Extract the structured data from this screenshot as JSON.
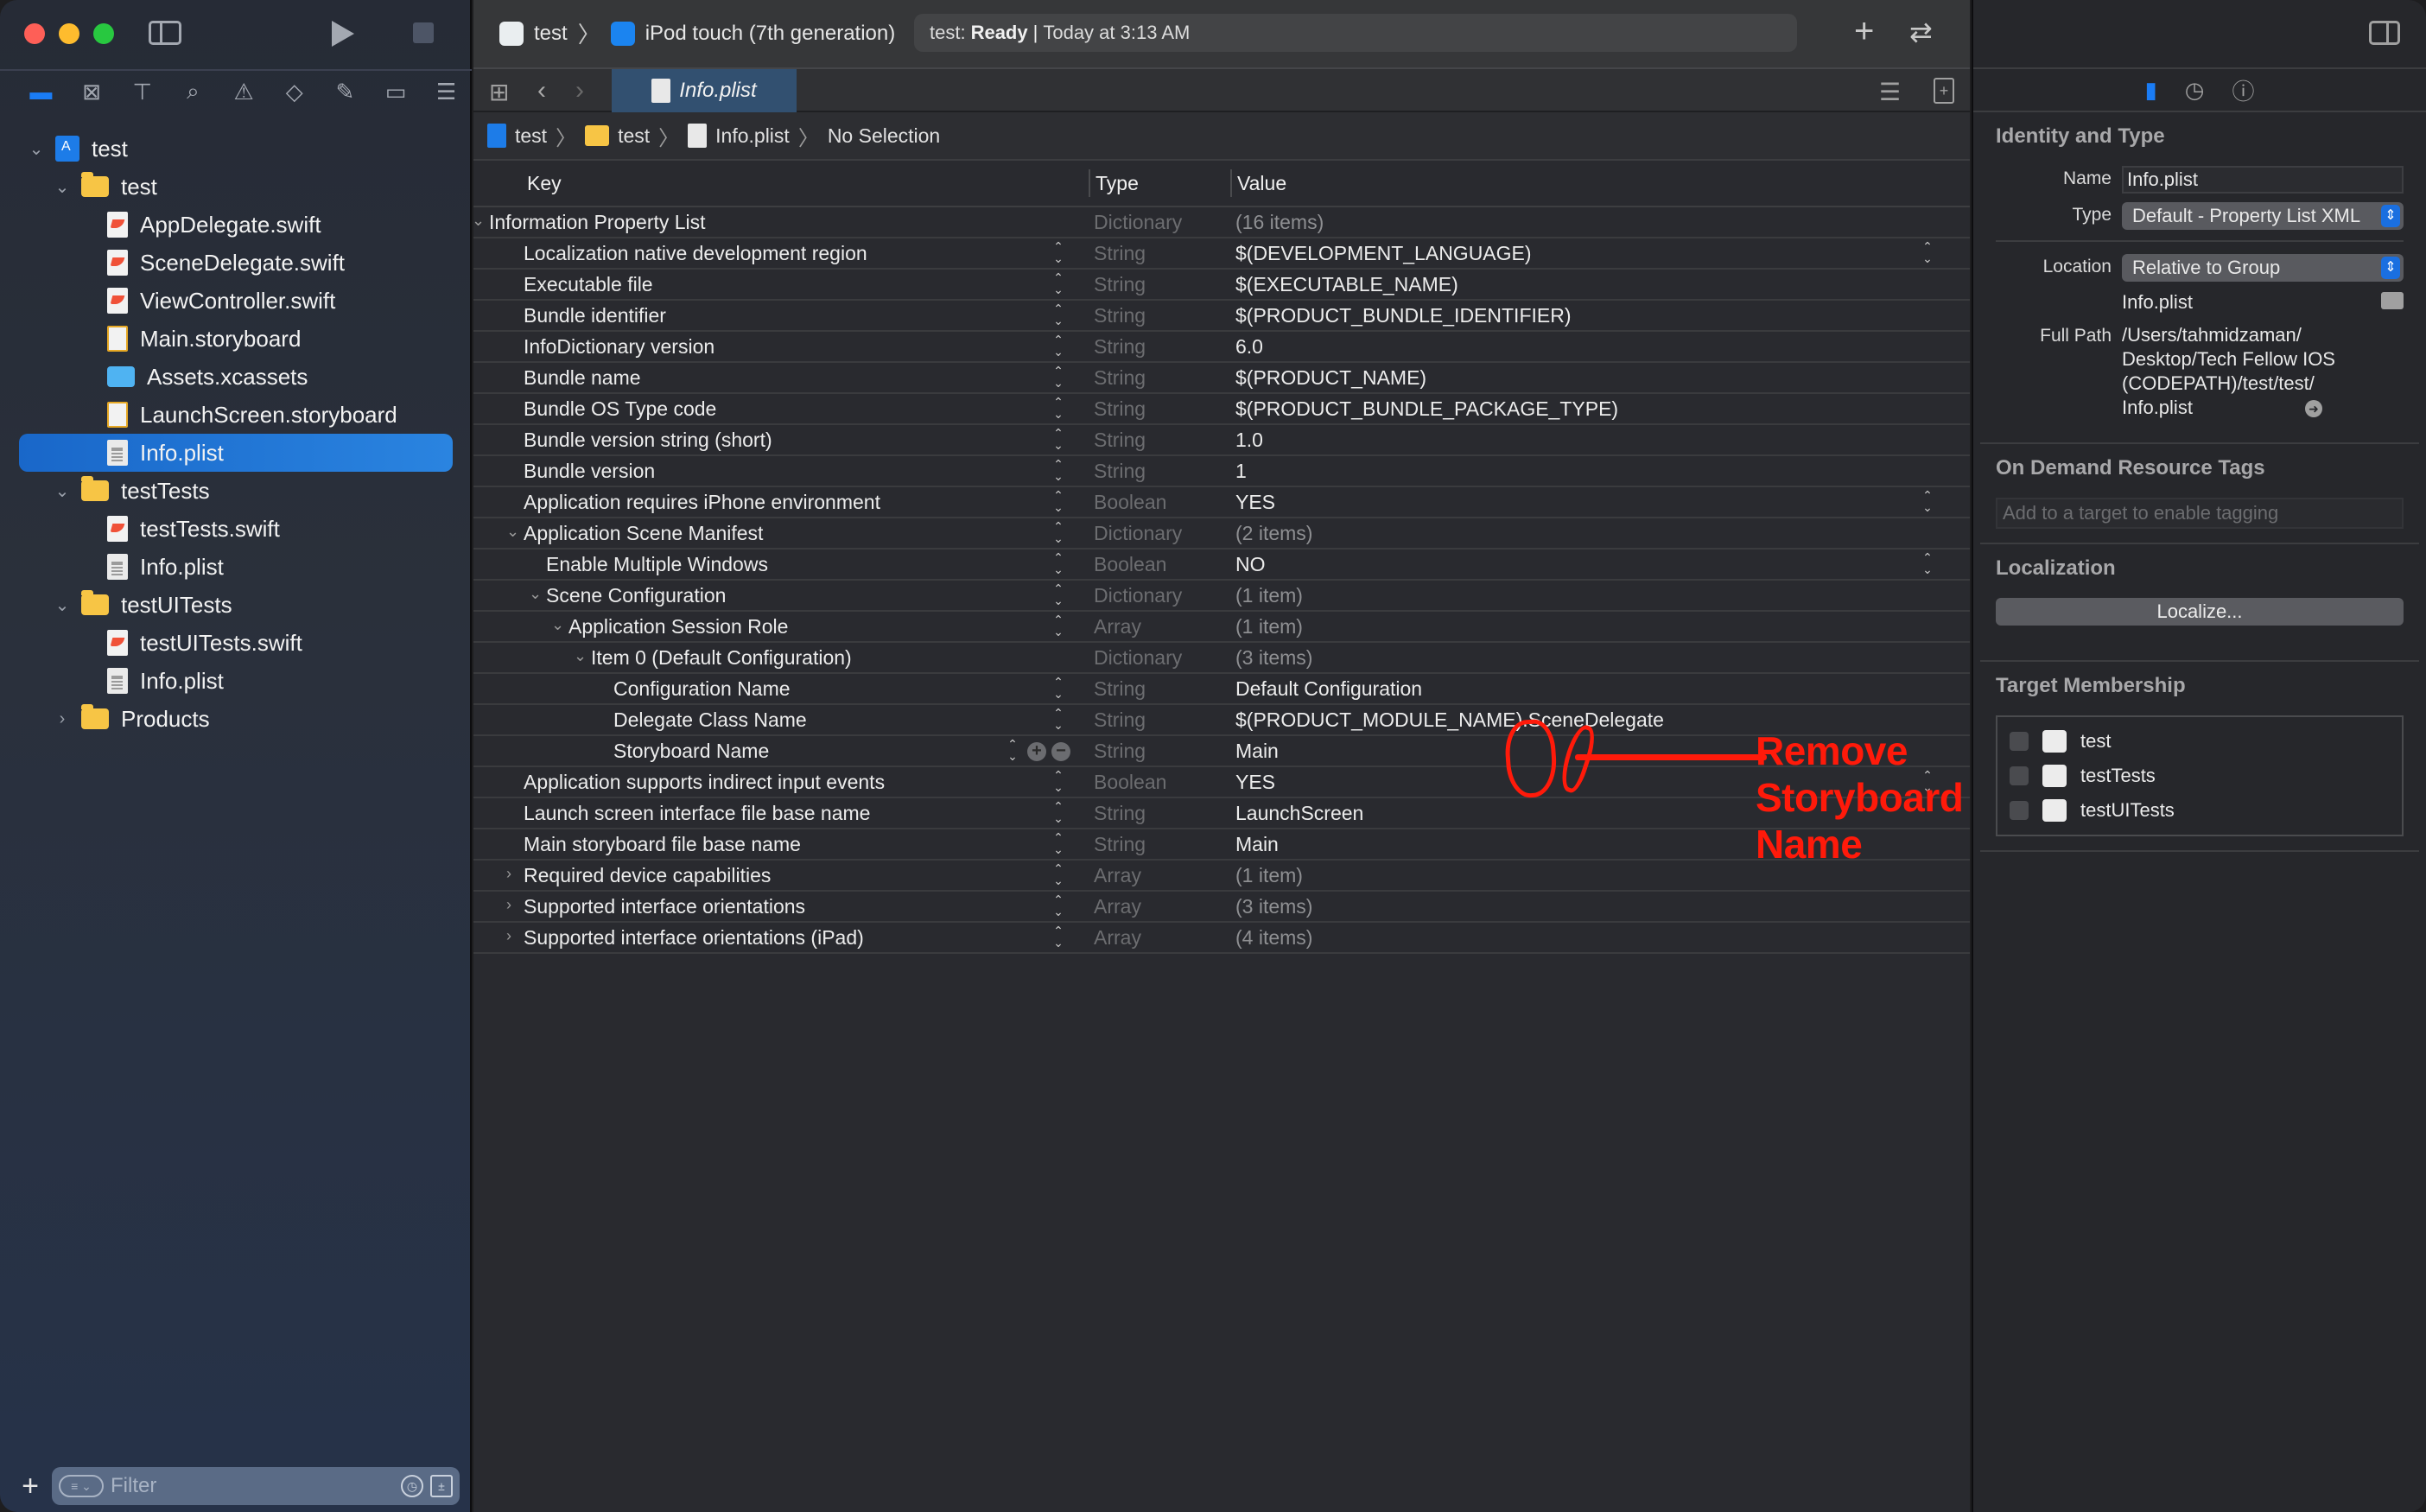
{
  "window": {
    "scheme": {
      "project": "test",
      "device": "iPod touch (7th generation)"
    },
    "status": {
      "prefix": "test:",
      "state": "Ready",
      "separator": "|",
      "time": "Today at 3:13 AM"
    }
  },
  "navigator": {
    "tabs": [
      "project-navigator",
      "source-control",
      "symbols",
      "find",
      "issues",
      "tests",
      "debug",
      "breakpoints",
      "reports"
    ],
    "tree": [
      {
        "label": "test",
        "icon": "project",
        "level": 0,
        "disclosure": "open"
      },
      {
        "label": "test",
        "icon": "folder",
        "level": 1,
        "disclosure": "open"
      },
      {
        "label": "AppDelegate.swift",
        "icon": "swift",
        "level": 2
      },
      {
        "label": "SceneDelegate.swift",
        "icon": "swift",
        "level": 2
      },
      {
        "label": "ViewController.swift",
        "icon": "swift",
        "level": 2
      },
      {
        "label": "Main.storyboard",
        "icon": "storyboard",
        "level": 2
      },
      {
        "label": "Assets.xcassets",
        "icon": "assets",
        "level": 2
      },
      {
        "label": "LaunchScreen.storyboard",
        "icon": "storyboard",
        "level": 2
      },
      {
        "label": "Info.plist",
        "icon": "plist",
        "level": 2,
        "selected": true
      },
      {
        "label": "testTests",
        "icon": "folder",
        "level": 1,
        "disclosure": "open"
      },
      {
        "label": "testTests.swift",
        "icon": "swift",
        "level": 2
      },
      {
        "label": "Info.plist",
        "icon": "plist",
        "level": 2
      },
      {
        "label": "testUITests",
        "icon": "folder",
        "level": 1,
        "disclosure": "open"
      },
      {
        "label": "testUITests.swift",
        "icon": "swift",
        "level": 2
      },
      {
        "label": "Info.plist",
        "icon": "plist",
        "level": 2
      },
      {
        "label": "Products",
        "icon": "folder",
        "level": 1,
        "disclosure": "closed"
      }
    ],
    "filter": {
      "placeholder": "Filter"
    }
  },
  "editor": {
    "tab": {
      "label": "Info.plist"
    },
    "jumpbar": [
      "test",
      "test",
      "Info.plist",
      "No Selection"
    ],
    "columns": {
      "key": "Key",
      "type": "Type",
      "value": "Value"
    },
    "rows": [
      {
        "key": "Information Property List",
        "type": "Dictionary",
        "value": "(16 items)",
        "level": 0,
        "disclosure": "open",
        "value_dim": true,
        "stepper": false
      },
      {
        "key": "Localization native development region",
        "type": "String",
        "value": "$(DEVELOPMENT_LANGUAGE)",
        "level": 1,
        "value_popup": true
      },
      {
        "key": "Executable file",
        "type": "String",
        "value": "$(EXECUTABLE_NAME)",
        "level": 1
      },
      {
        "key": "Bundle identifier",
        "type": "String",
        "value": "$(PRODUCT_BUNDLE_IDENTIFIER)",
        "level": 1
      },
      {
        "key": "InfoDictionary version",
        "type": "String",
        "value": "6.0",
        "level": 1
      },
      {
        "key": "Bundle name",
        "type": "String",
        "value": "$(PRODUCT_NAME)",
        "level": 1
      },
      {
        "key": "Bundle OS Type code",
        "type": "String",
        "value": "$(PRODUCT_BUNDLE_PACKAGE_TYPE)",
        "level": 1
      },
      {
        "key": "Bundle version string (short)",
        "type": "String",
        "value": "1.0",
        "level": 1
      },
      {
        "key": "Bundle version",
        "type": "String",
        "value": "1",
        "level": 1
      },
      {
        "key": "Application requires iPhone environment",
        "type": "Boolean",
        "value": "YES",
        "level": 1,
        "value_popup": true
      },
      {
        "key": "Application Scene Manifest",
        "type": "Dictionary",
        "value": "(2 items)",
        "level": 1,
        "disclosure": "open",
        "value_dim": true
      },
      {
        "key": "Enable Multiple Windows",
        "type": "Boolean",
        "value": "NO",
        "level": 2,
        "value_popup": true
      },
      {
        "key": "Scene Configuration",
        "type": "Dictionary",
        "value": "(1 item)",
        "level": 2,
        "disclosure": "open",
        "value_dim": true
      },
      {
        "key": "Application Session Role",
        "type": "Array",
        "value": "(1 item)",
        "level": 3,
        "disclosure": "open",
        "value_dim": true
      },
      {
        "key": "Item 0 (Default Configuration)",
        "type": "Dictionary",
        "value": "(3 items)",
        "level": 4,
        "disclosure": "open",
        "value_dim": true,
        "stepper": false
      },
      {
        "key": "Configuration Name",
        "type": "String",
        "value": "Default Configuration",
        "level": 5
      },
      {
        "key": "Delegate Class Name",
        "type": "String",
        "value": "$(PRODUCT_MODULE_NAME).SceneDelegate",
        "level": 5
      },
      {
        "key": "Storyboard Name",
        "type": "String",
        "value": "Main",
        "level": 5,
        "hover_buttons": true
      },
      {
        "key": "Application supports indirect input events",
        "type": "Boolean",
        "value": "YES",
        "level": 1,
        "value_popup": true
      },
      {
        "key": "Launch screen interface file base name",
        "type": "String",
        "value": "LaunchScreen",
        "level": 1
      },
      {
        "key": "Main storyboard file base name",
        "type": "String",
        "value": "Main",
        "level": 1
      },
      {
        "key": "Required device capabilities",
        "type": "Array",
        "value": "(1 item)",
        "level": 1,
        "disclosure": "closed",
        "value_dim": true
      },
      {
        "key": "Supported interface orientations",
        "type": "Array",
        "value": "(3 items)",
        "level": 1,
        "disclosure": "closed",
        "value_dim": true
      },
      {
        "key": "Supported interface orientations (iPad)",
        "type": "Array",
        "value": "(4 items)",
        "level": 1,
        "disclosure": "closed",
        "value_dim": true
      }
    ],
    "row_buttons": {
      "add": "+",
      "remove": "−"
    },
    "annotation": {
      "text": "Remove Storyboard Name",
      "color": "#ff1a0a"
    }
  },
  "inspector": {
    "tabs": [
      "file-inspector",
      "history-inspector",
      "quick-help"
    ],
    "identity": {
      "title": "Identity and Type",
      "name_label": "Name",
      "name_value": "Info.plist",
      "type_label": "Type",
      "type_value": "Default - Property List XML",
      "location_label": "Location",
      "location_value": "Relative to Group",
      "location_file": "Info.plist",
      "fullpath_label": "Full Path",
      "fullpath_lines": [
        "/Users/tahmidzaman/",
        "Desktop/Tech Fellow IOS",
        "(CODEPATH)/test/test/",
        "Info.plist"
      ]
    },
    "odr": {
      "title": "On Demand Resource Tags",
      "placeholder": "Add to a target to enable tagging"
    },
    "localization": {
      "title": "Localization",
      "button": "Localize..."
    },
    "targets": {
      "title": "Target Membership",
      "items": [
        {
          "label": "test",
          "checked": false,
          "icon": "app"
        },
        {
          "label": "testTests",
          "checked": false,
          "icon": "bundle"
        },
        {
          "label": "testUITests",
          "checked": false,
          "icon": "bundle"
        }
      ]
    }
  },
  "colors": {
    "accent": "#1a7cf5",
    "selection": "#1f6fd0",
    "annotation": "#ff1a0a"
  }
}
